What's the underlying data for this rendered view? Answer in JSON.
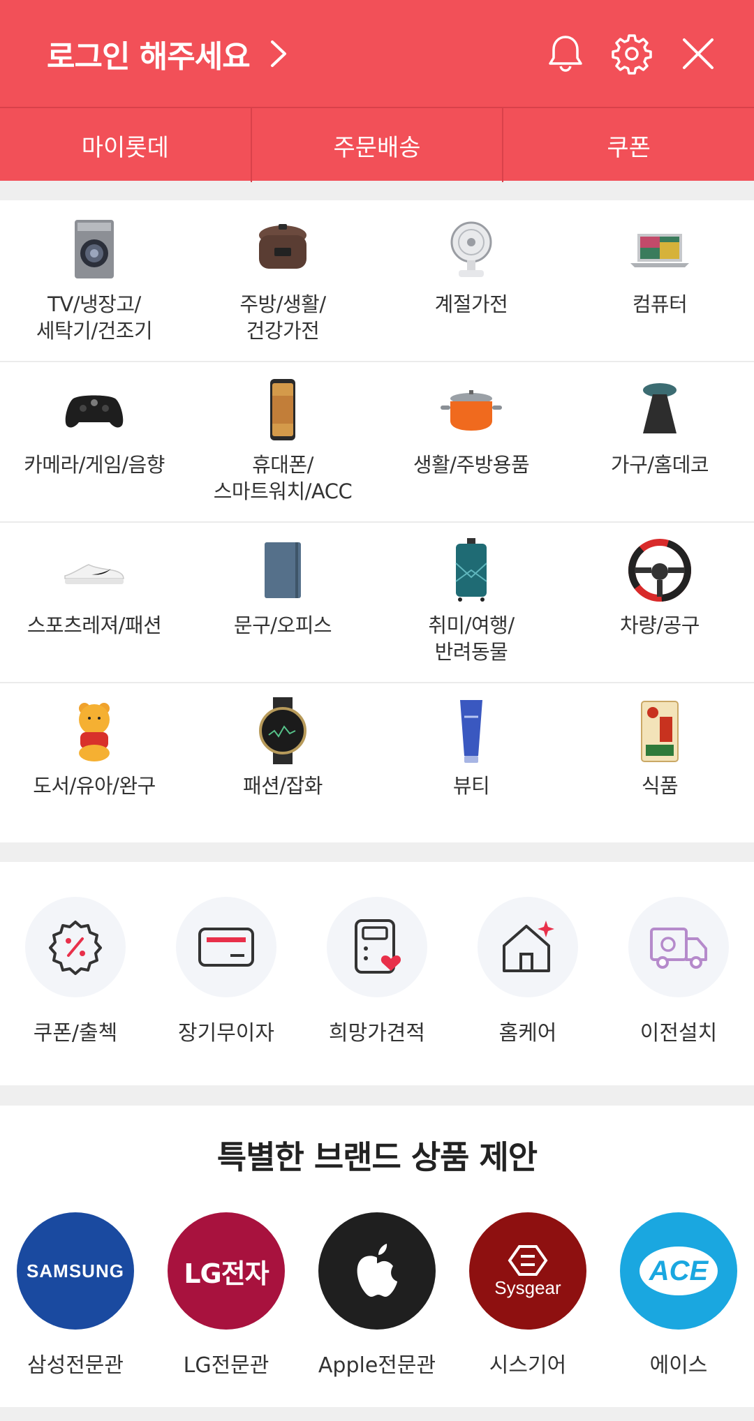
{
  "header": {
    "login_label": "로그인 해주세요",
    "icons": [
      "bell-icon",
      "gear-icon",
      "close-icon"
    ],
    "tabs": [
      {
        "label": "마이롯데"
      },
      {
        "label": "주문배송"
      },
      {
        "label": "쿠폰"
      }
    ]
  },
  "categories": [
    {
      "label": "TV/냉장고/\n세탁기/건조기",
      "icon": "washer-icon"
    },
    {
      "label": "주방/생활/\n건강가전",
      "icon": "rice-cooker-icon"
    },
    {
      "label": "계절가전",
      "icon": "fan-icon"
    },
    {
      "label": "컴퓨터",
      "icon": "laptop-icon"
    },
    {
      "label": "카메라/게임/음향",
      "icon": "gamepad-icon"
    },
    {
      "label": "휴대폰/\n스마트워치/ACC",
      "icon": "smartphone-icon"
    },
    {
      "label": "생활/주방용품",
      "icon": "pot-icon"
    },
    {
      "label": "가구/홈데코",
      "icon": "stool-icon"
    },
    {
      "label": "스포츠레져/패션",
      "icon": "sneaker-icon"
    },
    {
      "label": "문구/오피스",
      "icon": "notebook-icon"
    },
    {
      "label": "취미/여행/\n반려동물",
      "icon": "suitcase-icon"
    },
    {
      "label": "차량/공구",
      "icon": "steering-wheel-icon"
    },
    {
      "label": "도서/유아/완구",
      "icon": "bear-toy-icon"
    },
    {
      "label": "패션/잡화",
      "icon": "watch-icon"
    },
    {
      "label": "뷰티",
      "icon": "cleanser-tube-icon"
    },
    {
      "label": "식품",
      "icon": "rice-bag-icon"
    }
  ],
  "services": [
    {
      "label": "쿠폰/출첵",
      "icon": "coupon-percent-icon"
    },
    {
      "label": "장기무이자",
      "icon": "credit-card-icon"
    },
    {
      "label": "희망가견적",
      "icon": "calculator-heart-icon"
    },
    {
      "label": "홈케어",
      "icon": "home-sparkle-icon"
    },
    {
      "label": "이전설치",
      "icon": "moving-truck-icon"
    }
  ],
  "brand_section": {
    "title": "특별한 브랜드 상품 제안",
    "brands": [
      {
        "label": "삼성전문관",
        "logo_text": "SAMSUNG",
        "color": "#1a4aa0"
      },
      {
        "label": "LG전문관",
        "logo_text": "LG전자",
        "color": "#a8123e"
      },
      {
        "label": "Apple전문관",
        "logo_text": "",
        "color": "#1f1f1f"
      },
      {
        "label": "시스기어",
        "logo_text": "Sysgear",
        "color": "#8e1010"
      },
      {
        "label": "에이스",
        "logo_text": "ACE",
        "color": "#1aa7e0"
      }
    ]
  },
  "colors": {
    "header": "#f25058",
    "divider": "#d9414a",
    "accent": "#e8304a"
  }
}
